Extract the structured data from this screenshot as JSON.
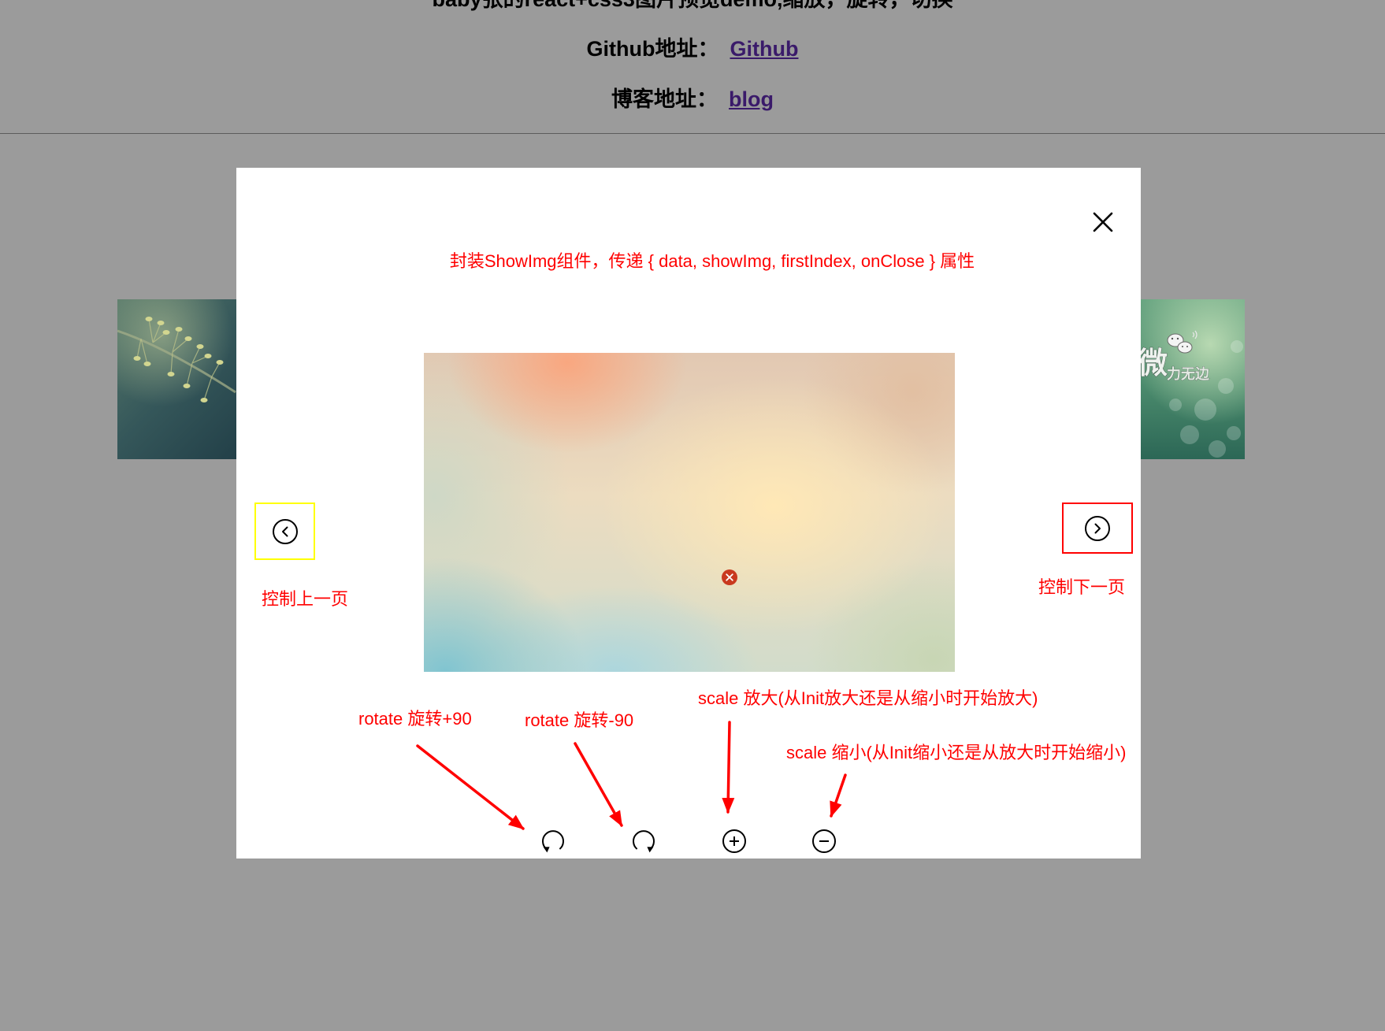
{
  "page": {
    "background": "#9b9b9b"
  },
  "header": {
    "title": "baby张的react+css3图片预览demo,缩放，旋转，切换",
    "github_label": "Github地址：",
    "github_link": "Github",
    "blog_label": "博客地址：",
    "blog_link": "blog",
    "link_color": "#3a1a6a"
  },
  "gallery": {
    "right_thumb_logo_big": "微",
    "right_thumb_logo_small": "力无边",
    "right_thumb_icon": "wechat-icon"
  },
  "viewer": {
    "close_icon": "close-icon",
    "image_error_icon": "broken-image-icon",
    "prev_icon": "chevron-left-circle-icon",
    "next_icon": "chevron-right-circle-icon",
    "toolbar": [
      {
        "icon": "rotate-left-icon"
      },
      {
        "icon": "rotate-right-icon"
      },
      {
        "icon": "zoom-in-icon"
      },
      {
        "icon": "zoom-out-icon"
      }
    ]
  },
  "annotations": {
    "color": "#ff0000",
    "prev_frame_color": "#ffff00",
    "next_frame_color": "#ff0000",
    "component_note": "封装ShowImg组件，传递 { data, showImg, firstIndex, onClose } 属性",
    "prev_note": "控制上一页",
    "next_note": "控制下一页",
    "rotate_plus_note": "rotate 旋转+90",
    "rotate_minus_note": "rotate 旋转-90",
    "zoom_in_note": "scale 放大(从Init放大还是从缩小时开始放大)",
    "zoom_out_note": "scale 缩小(从Init缩小还是从放大时开始缩小)"
  }
}
